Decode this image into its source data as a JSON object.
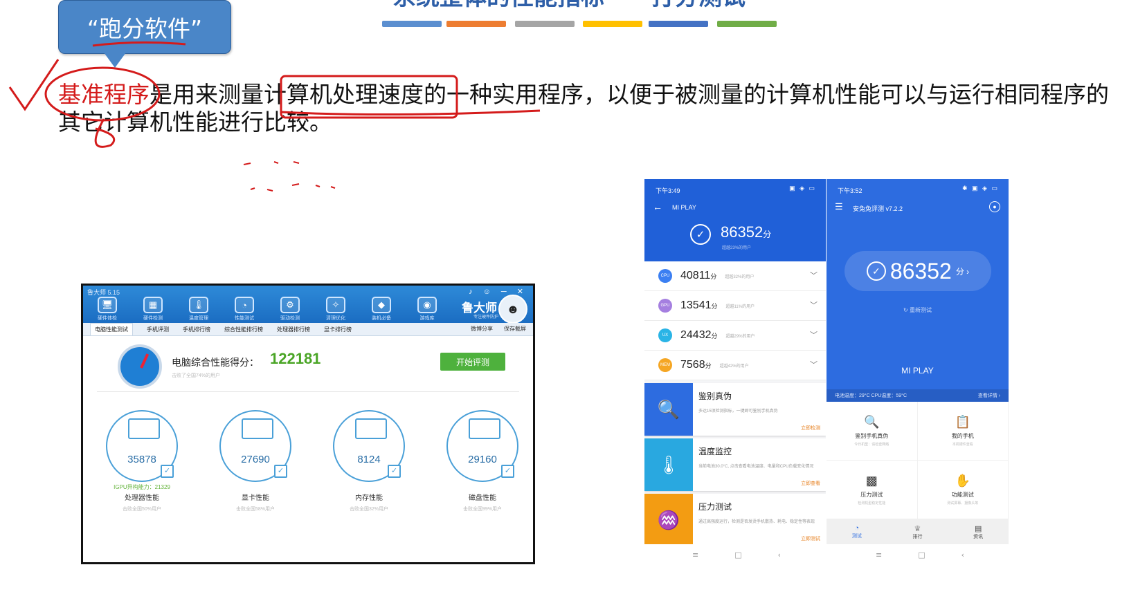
{
  "slide": {
    "title": "系统整体的性能指标——打分测试",
    "color_bars": [
      "#5b8fd0",
      "#ed7d31",
      "#a5a5a5",
      "#ffc000",
      "#4472c4",
      "#70ad47"
    ],
    "callout": "“跑分软件”",
    "definition": {
      "term": "基准程序",
      "text": "是用来测量计算机处理速度的一种实用程序，以便于被测量的计算机性能可以与运行相同程序的其它计算机性能进行比较。"
    }
  },
  "ludashi": {
    "window_title": "鲁大师 5.15",
    "window_controls": "♪ ☺ ─ ✕",
    "tools": [
      {
        "label": "硬件体检",
        "icon": "monitor-icon",
        "glyph": "🖥"
      },
      {
        "label": "硬件检测",
        "icon": "chip-icon",
        "glyph": "▦"
      },
      {
        "label": "温度管理",
        "icon": "thermometer-icon",
        "glyph": "🌡"
      },
      {
        "label": "性能测试",
        "icon": "speedometer-icon",
        "glyph": "◔"
      },
      {
        "label": "驱动检测",
        "icon": "gear-icon",
        "glyph": "⚙"
      },
      {
        "label": "清理优化",
        "icon": "broom-icon",
        "glyph": "✧"
      },
      {
        "label": "装机必备",
        "icon": "cube-icon",
        "glyph": "◆"
      },
      {
        "label": "游戏库",
        "icon": "gamepad-icon",
        "glyph": "◉"
      }
    ],
    "brand": "鲁大师",
    "brand_sub": "专注硬件防护",
    "tabs": [
      "电脑性能测试",
      "手机评测",
      "手机排行榜",
      "综合性能排行榜",
      "处理器排行榜",
      "显卡排行榜"
    ],
    "share": "微博分享",
    "save": "保存截屏",
    "score_label": "电脑综合性能得分：",
    "score_value": "122181",
    "score_sub": "击败了全国74%的用户",
    "start_button": "开始评测",
    "items": [
      {
        "value": "35878",
        "gpu": "IGPU异构能力：21329",
        "label": "处理器性能",
        "sub": "击败全国50%用户"
      },
      {
        "value": "27690",
        "gpu": "",
        "label": "显卡性能",
        "sub": "击败全国58%用户"
      },
      {
        "value": "8124",
        "gpu": "",
        "label": "内存性能",
        "sub": "击败全国32%用户"
      },
      {
        "value": "29160",
        "gpu": "",
        "label": "磁盘性能",
        "sub": "击败全国99%用户"
      }
    ]
  },
  "phone1": {
    "time": "下午3:49",
    "status_icons": "▣ ◈ ▭",
    "title": "MI PLAY",
    "score": "86352",
    "score_unit": "分",
    "score_sub": "超越23%的用户",
    "rows": [
      {
        "badge": "CPU",
        "value": "40811",
        "unit": "分",
        "pct": "超越32%的用户",
        "color": "#3b7ff2"
      },
      {
        "badge": "GPU",
        "value": "13541",
        "unit": "分",
        "pct": "超越11%的用户",
        "color": "#a57fe0"
      },
      {
        "badge": "UX",
        "value": "24432",
        "unit": "分",
        "pct": "超越29%的用户",
        "color": "#2ab4e6"
      },
      {
        "badge": "MEM",
        "value": "7568",
        "unit": "分",
        "pct": "超越42%的用户",
        "color": "#f5a623"
      }
    ],
    "cards": [
      {
        "title": "鉴别真伪",
        "desc": "多达15项检测指标，一键即可鉴别手机真伪",
        "action": "立即检测",
        "color": "#2d6ce0",
        "glyph": "🔍"
      },
      {
        "title": "温度监控",
        "desc": "当前电池30.0°C, 点击查看电池温度、电量和CPU负载变化情况",
        "action": "立即查看",
        "color": "#29a8e0",
        "glyph": "🌡"
      },
      {
        "title": "压力测试",
        "desc": "通过高强度运行，检测是否发烫手机散热、耗电、稳定性等表现",
        "action": "立即测试",
        "color": "#f39c12",
        "glyph": "♒"
      }
    ]
  },
  "phone2": {
    "time": "下午3:52",
    "status_icons": "✱ ▣ ◈ ▭",
    "app_title": "安兔兔评测 v7.2.2",
    "score": "86352",
    "score_unit": "分 ›",
    "retest": "重新测试",
    "device": "MI PLAY",
    "temps": "电池温度：29°C  CPU温度：59°C",
    "details": "查看详情 ›",
    "grid": [
      {
        "label": "鉴别手机真伪",
        "sub": "今日机型：请检查网络",
        "glyph": "🔍"
      },
      {
        "label": "我的手机",
        "sub": "本机硬件查看",
        "glyph": "📋"
      },
      {
        "label": "压力测试",
        "sub": "检测机型稳定性能",
        "glyph": "▩"
      },
      {
        "label": "功能测试",
        "sub": "测试屏幕、摄像头等",
        "glyph": "✋"
      }
    ],
    "nav": [
      {
        "label": "测试",
        "glyph": "◔"
      },
      {
        "label": "排行",
        "glyph": "♕"
      },
      {
        "label": "资讯",
        "glyph": "▤"
      }
    ]
  },
  "sys_nav": [
    "≡",
    "□",
    "‹"
  ]
}
